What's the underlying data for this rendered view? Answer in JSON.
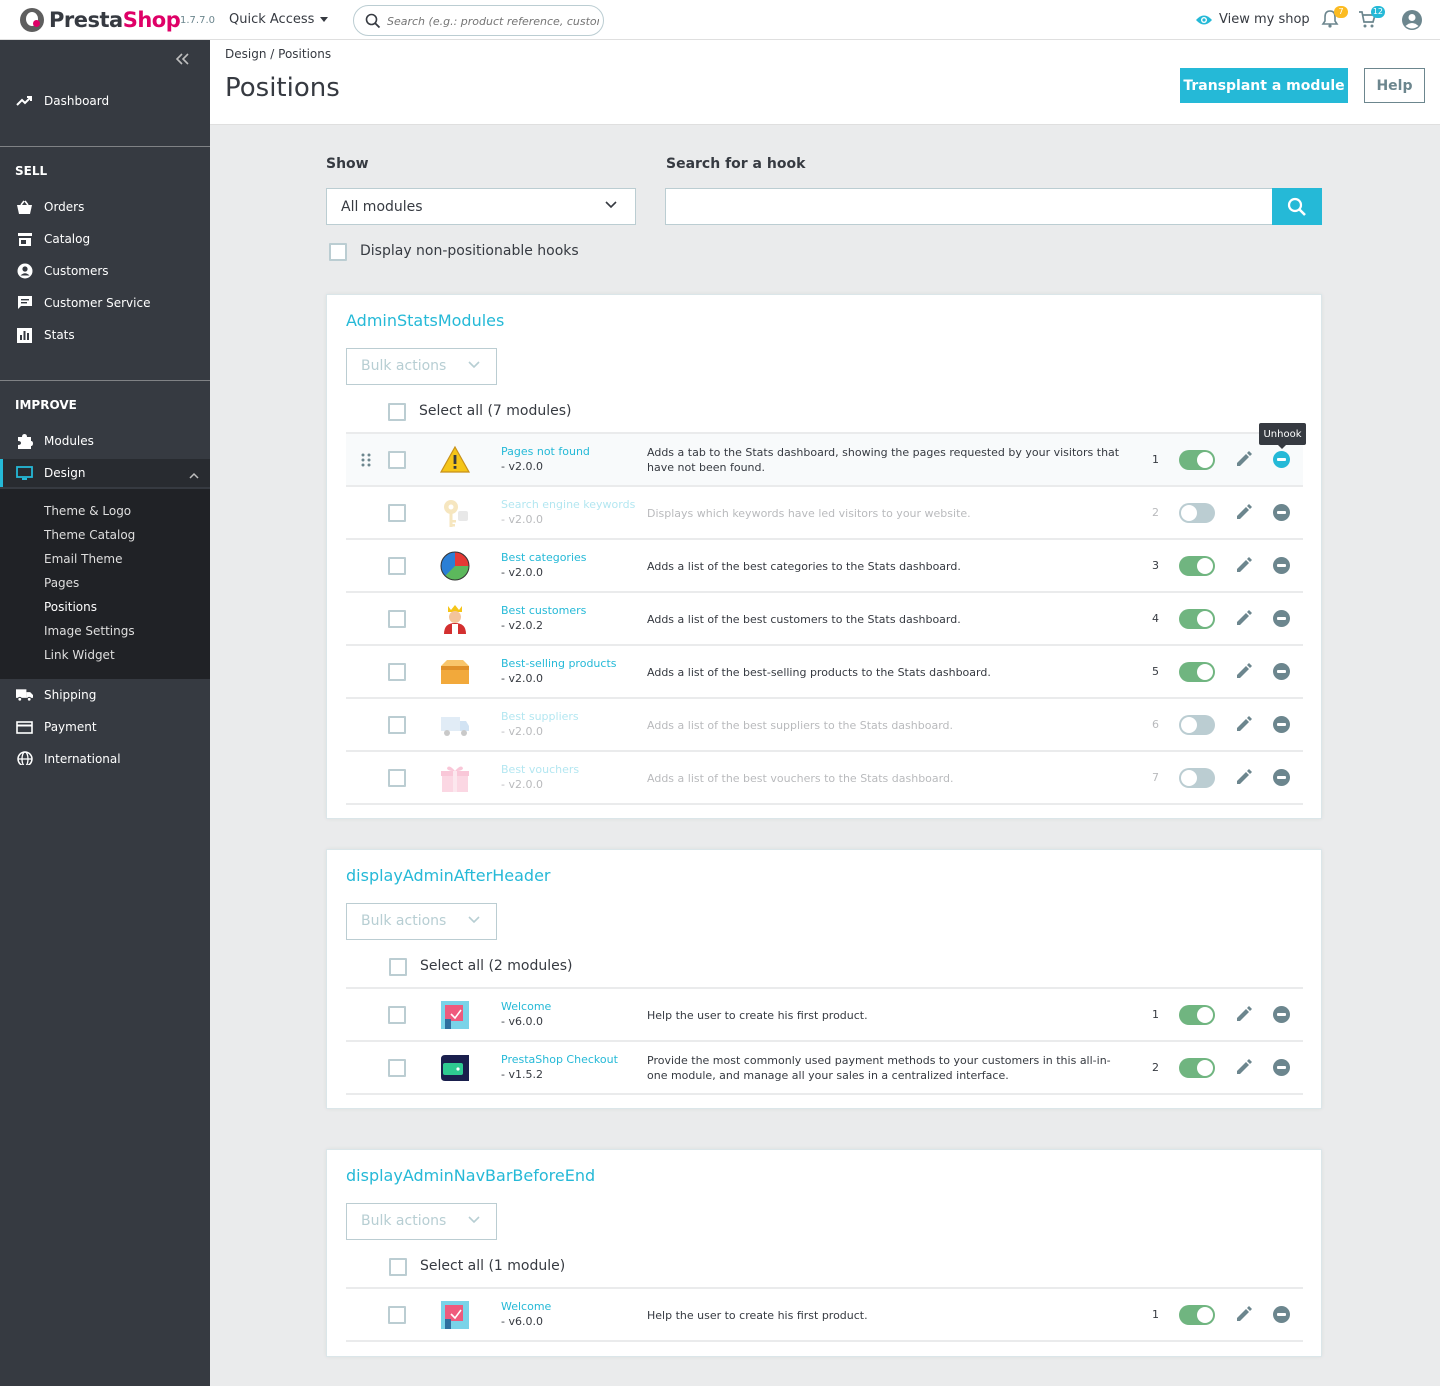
{
  "header": {
    "logo_text_presta": "Presta",
    "logo_text_shop": "Shop",
    "version": "1.7.7.0",
    "quick_access": "Quick Access",
    "search_placeholder": "Search (e.g.: product reference, custome",
    "view_shop": "View my shop",
    "notifications_count": "7",
    "orders_count": "12",
    "accent_color": "#25b9d7",
    "brand_color": "#df0067"
  },
  "sidebar": {
    "dashboard": "Dashboard",
    "sell_title": "SELL",
    "sell_items": [
      "Orders",
      "Catalog",
      "Customers",
      "Customer Service",
      "Stats"
    ],
    "improve_title": "IMPROVE",
    "modules": "Modules",
    "design": "Design",
    "design_sub": [
      "Theme & Logo",
      "Theme Catalog",
      "Email Theme",
      "Pages",
      "Positions",
      "Image Settings",
      "Link Widget"
    ],
    "shipping": "Shipping",
    "payment": "Payment",
    "international": "International"
  },
  "page": {
    "breadcrumb_parent": "Design",
    "breadcrumb_sep": "/",
    "breadcrumb_current": "Positions",
    "title": "Positions",
    "transplant_button": "Transplant a module",
    "help_button": "Help"
  },
  "filters": {
    "show_label": "Show",
    "show_value": "All modules",
    "hook_label": "Search for a hook",
    "hook_value": "",
    "non_positionable": "Display non-positionable hooks"
  },
  "tooltip": "Unhook",
  "hooks": [
    {
      "name": "AdminStatsModules",
      "bulk": "Bulk actions",
      "select_all": "Select all (7 modules)",
      "modules": [
        {
          "name": "Pages not found",
          "version": "- v2.0.0",
          "desc": "Adds a tab to the Stats dashboard, showing the pages requested by your visitors that have not been found.",
          "pos": "1",
          "enabled": true,
          "icon": "warning-icon"
        },
        {
          "name": "Search engine keywords",
          "version": "- v2.0.0",
          "desc": "Displays which keywords have led visitors to your website.",
          "pos": "2",
          "enabled": false,
          "icon": "keys-icon"
        },
        {
          "name": "Best categories",
          "version": "- v2.0.0",
          "desc": "Adds a list of the best categories to the Stats dashboard.",
          "pos": "3",
          "enabled": true,
          "icon": "pie-chart-icon"
        },
        {
          "name": "Best customers",
          "version": "- v2.0.2",
          "desc": "Adds a list of the best customers to the Stats dashboard.",
          "pos": "4",
          "enabled": true,
          "icon": "king-icon"
        },
        {
          "name": "Best-selling products",
          "version": "- v2.0.0",
          "desc": "Adds a list of the best-selling products to the Stats dashboard.",
          "pos": "5",
          "enabled": true,
          "icon": "box-icon"
        },
        {
          "name": "Best suppliers",
          "version": "- v2.0.0",
          "desc": "Adds a list of the best suppliers to the Stats dashboard.",
          "pos": "6",
          "enabled": false,
          "icon": "truck-icon"
        },
        {
          "name": "Best vouchers",
          "version": "- v2.0.0",
          "desc": "Adds a list of the best vouchers to the Stats dashboard.",
          "pos": "7",
          "enabled": false,
          "icon": "gift-icon"
        }
      ]
    },
    {
      "name": "displayAdminAfterHeader",
      "bulk": "Bulk actions",
      "select_all": "Select all (2 modules)",
      "modules": [
        {
          "name": "Welcome",
          "version": "- v6.0.0",
          "desc": "Help the user to create his first product.",
          "pos": "1",
          "enabled": true,
          "icon": "welcome-icon"
        },
        {
          "name": "PrestaShop Checkout",
          "version": "- v1.5.2",
          "desc": "Provide the most commonly used payment methods to your customers in this all-in-one module, and manage all your sales in a centralized interface.",
          "pos": "2",
          "enabled": true,
          "icon": "checkout-icon"
        }
      ]
    },
    {
      "name": "displayAdminNavBarBeforeEnd",
      "bulk": "Bulk actions",
      "select_all": "Select all (1 module)",
      "modules": [
        {
          "name": "Welcome",
          "version": "- v6.0.0",
          "desc": "Help the user to create his first product.",
          "pos": "1",
          "enabled": true,
          "icon": "welcome-icon"
        }
      ]
    }
  ]
}
